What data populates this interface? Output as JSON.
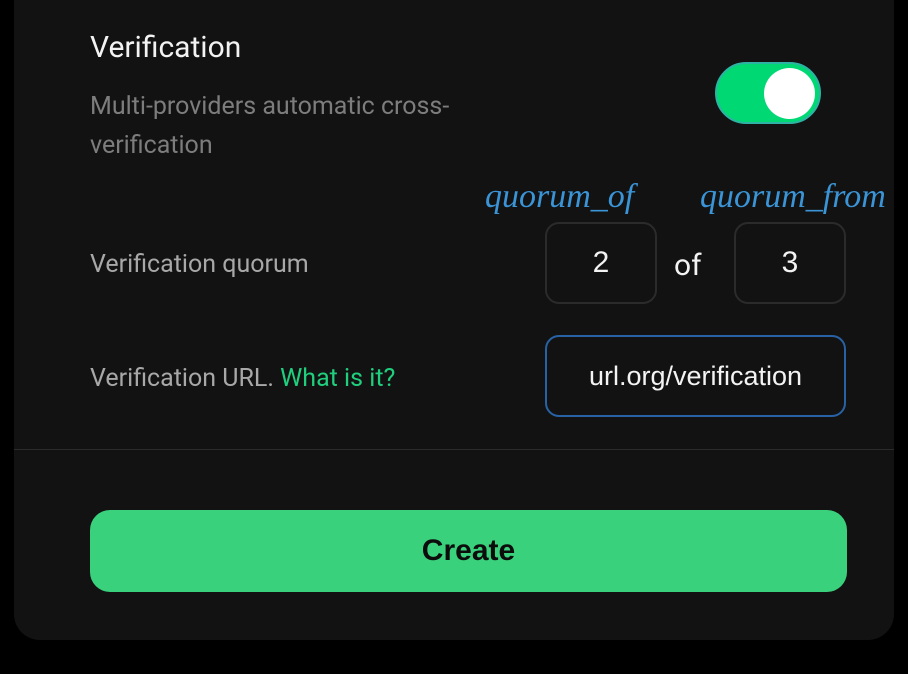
{
  "verification": {
    "title": "Verification",
    "subtitle": "Multi-providers automatic cross-verification",
    "toggle_on": true
  },
  "quorum": {
    "label": "Verification quorum",
    "of_text": "of",
    "value_of": "2",
    "value_from": "3",
    "annotation_of": "quorum_of",
    "annotation_from": "quorum_from"
  },
  "url": {
    "label": "Verification URL. ",
    "link_text": "What is it?",
    "value": "url.org/verification"
  },
  "actions": {
    "create_label": "Create"
  }
}
